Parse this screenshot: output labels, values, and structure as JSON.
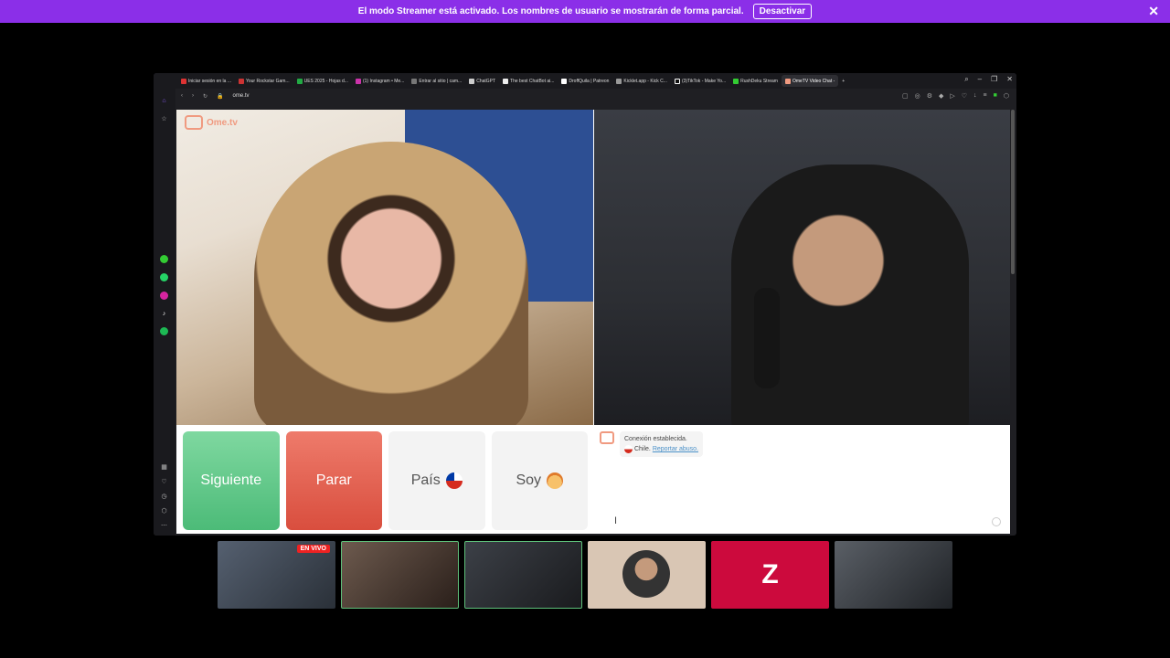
{
  "streamer_bar": {
    "message": "El modo Streamer está activado. Los nombres de usuario se mostrarán de forma parcial.",
    "button": "Desactivar"
  },
  "tabs": [
    "Iniciar sesión en la ...",
    "Your Rockstar Gam...",
    "UES 2025 - Hojas d...",
    "(1) Instagram • Me...",
    "Entrar al sitio | cam...",
    "ChatGPT",
    "The best ChatBot ai...",
    "DroffQuila | Patreon",
    "Kicklet.app - Kick C...",
    "(3)TikTok - Make Yo...",
    "RushDeku Stream",
    "OmeTV Video Chat -"
  ],
  "address": {
    "url": "ome.tv"
  },
  "site": {
    "logo": "Ome.tv"
  },
  "controls": {
    "next": "Siguiente",
    "stop": "Parar",
    "country": "País",
    "me": "Soy"
  },
  "chat": {
    "status": "Conexión establecida.",
    "country": "Chile.",
    "report": "Reportar abuso."
  },
  "thumbs": {
    "live_badge": "EN VIVO",
    "z_logo": "Z"
  },
  "colors": {
    "streamer_bar": "#8b2fe8",
    "next": "#4cbb78",
    "stop": "#d94e3e",
    "brand": "#f09a80"
  }
}
